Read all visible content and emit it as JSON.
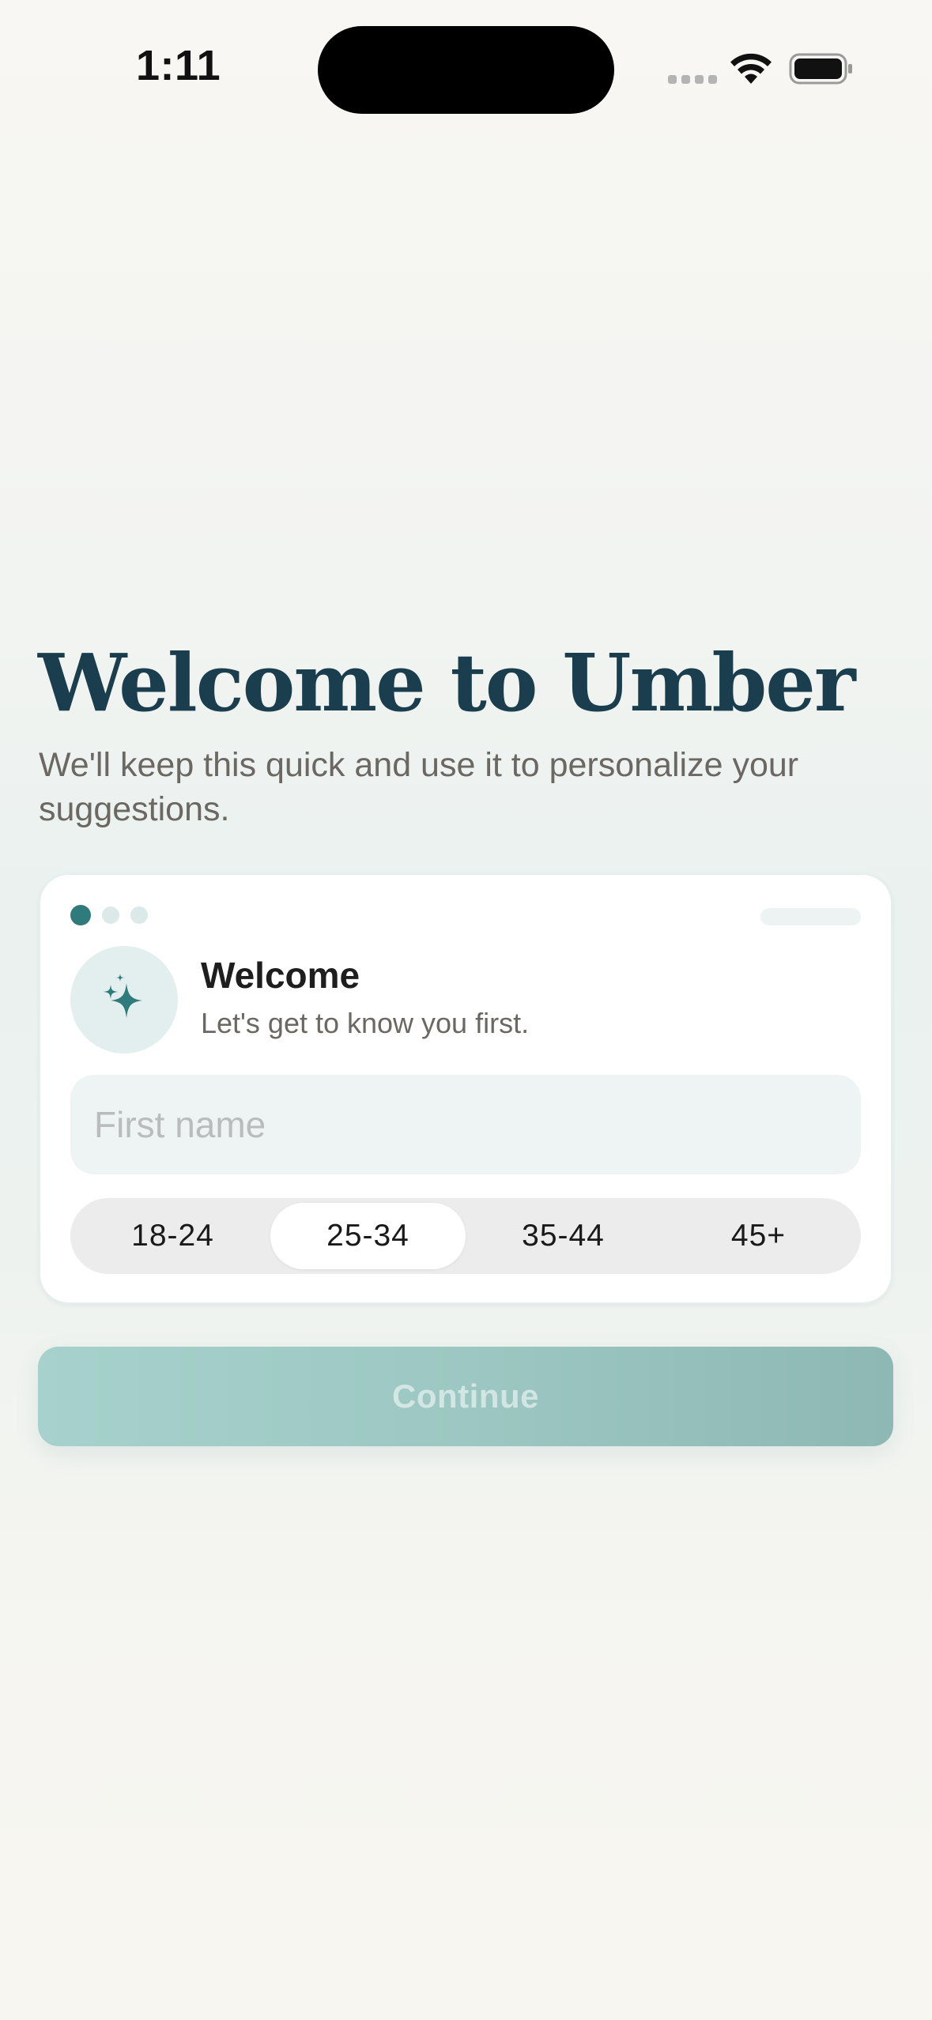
{
  "status_bar": {
    "time": "1:11"
  },
  "header": {
    "title": "Welcome to Umber",
    "subtitle": "We'll keep this quick and use it to personalize your suggestions."
  },
  "card": {
    "progress": {
      "current_step": 1,
      "total_steps": 3
    },
    "icon": "sparkles-icon",
    "title": "Welcome",
    "subtitle": "Let's get to know you first.",
    "name_field": {
      "placeholder": "First name",
      "value": ""
    },
    "age_ranges": {
      "options": [
        "18-24",
        "25-34",
        "35-44",
        "45+"
      ],
      "selected": "25-34"
    }
  },
  "continue_button": {
    "label": "Continue",
    "enabled": false
  },
  "colors": {
    "accent": "#2f7b7c",
    "title": "#1a3e4e",
    "button": "#9cc7c2"
  }
}
